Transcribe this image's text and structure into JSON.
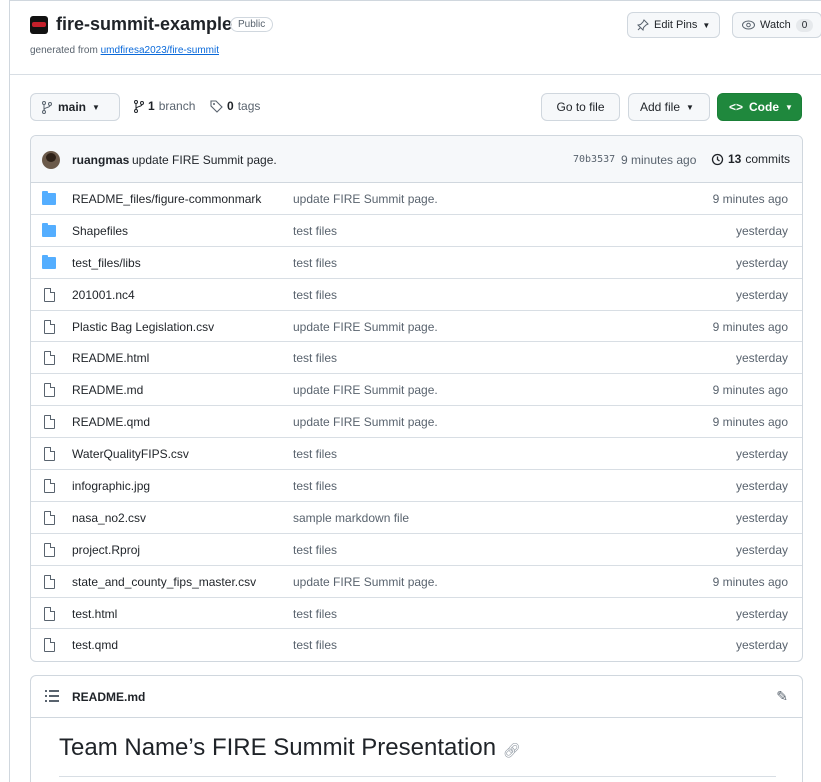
{
  "repo": {
    "name": "fire-summit-example",
    "visibility": "Public",
    "generated_prefix": "generated from ",
    "generated_link": "umdfiresa2023/fire-summit"
  },
  "header_buttons": {
    "edit_pins": "Edit Pins",
    "watch": "Watch",
    "watch_count": "0"
  },
  "toolbar": {
    "branch": "main",
    "branch_count": "1",
    "branch_word": "branch",
    "tag_count": "0",
    "tag_word": "tags",
    "go_to_file": "Go to file",
    "add_file": "Add file",
    "code": "Code"
  },
  "latest_commit": {
    "author": "ruangmas",
    "message": "update FIRE Summit page.",
    "sha": "70b3537",
    "time": "9 minutes ago",
    "commit_count": "13",
    "commit_word": "commits"
  },
  "files": [
    {
      "type": "folder",
      "name": "README_files/figure-commonmark",
      "message": "update FIRE Summit page.",
      "date": "9 minutes ago"
    },
    {
      "type": "folder",
      "name": "Shapefiles",
      "message": "test files",
      "date": "yesterday"
    },
    {
      "type": "folder",
      "name": "test_files/libs",
      "message": "test files",
      "date": "yesterday"
    },
    {
      "type": "file",
      "name": "201001.nc4",
      "message": "test files",
      "date": "yesterday"
    },
    {
      "type": "file",
      "name": "Plastic Bag Legislation.csv",
      "message": "update FIRE Summit page.",
      "date": "9 minutes ago"
    },
    {
      "type": "file",
      "name": "README.html",
      "message": "test files",
      "date": "yesterday"
    },
    {
      "type": "file",
      "name": "README.md",
      "message": "update FIRE Summit page.",
      "date": "9 minutes ago"
    },
    {
      "type": "file",
      "name": "README.qmd",
      "message": "update FIRE Summit page.",
      "date": "9 minutes ago"
    },
    {
      "type": "file",
      "name": "WaterQualityFIPS.csv",
      "message": "test files",
      "date": "yesterday"
    },
    {
      "type": "file",
      "name": "infographic.jpg",
      "message": "test files",
      "date": "yesterday"
    },
    {
      "type": "file",
      "name": "nasa_no2.csv",
      "message": "sample markdown file",
      "date": "yesterday"
    },
    {
      "type": "file",
      "name": "project.Rproj",
      "message": "test files",
      "date": "yesterday"
    },
    {
      "type": "file",
      "name": "state_and_county_fips_master.csv",
      "message": "update FIRE Summit page.",
      "date": "9 minutes ago"
    },
    {
      "type": "file",
      "name": "test.html",
      "message": "test files",
      "date": "yesterday"
    },
    {
      "type": "file",
      "name": "test.qmd",
      "message": "test files",
      "date": "yesterday"
    }
  ],
  "readme": {
    "filename": "README.md",
    "heading": "Team Name’s FIRE Summit Presentation"
  }
}
